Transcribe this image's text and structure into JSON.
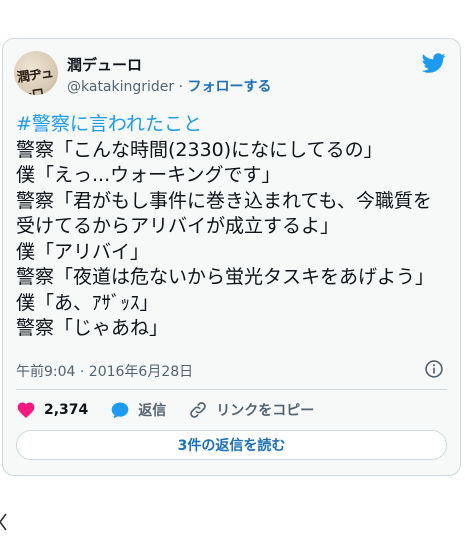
{
  "user": {
    "name": "潤デューロ",
    "handle": "@katakingrider",
    "separator": "·",
    "follow_label": "フォローする",
    "avatar_text": "潤ジデューロ"
  },
  "tweet": {
    "hashtag": "#警察に言われたこと",
    "lines": [
      "警察「こんな時間(2330)になにしてるの」",
      "僕「えっ...ウォーキングです」",
      "警察「君がもし事件に巻き込まれても、今職質を受けてるからアリバイが成立するよ」",
      "僕「アリバイ」",
      "警察「夜道は危ないから蛍光タスキをあげよう」",
      "僕「あ、ｱｻﾞｯｽ」",
      "警察「じゃあね」"
    ],
    "timestamp": "午前9:04 · 2016年6月28日"
  },
  "actions": {
    "like_count": "2,374",
    "reply_label": "返信",
    "copy_link_label": "リンクをコピー"
  },
  "replies_button": "3件の返信を読む",
  "colors": {
    "accent": "#1d9bf0",
    "like": "#f91880",
    "link": "#1d70b8"
  },
  "icons": [
    "twitter-icon",
    "info-icon",
    "heart-icon",
    "reply-icon",
    "link-icon",
    "chevron-left-icon"
  ]
}
